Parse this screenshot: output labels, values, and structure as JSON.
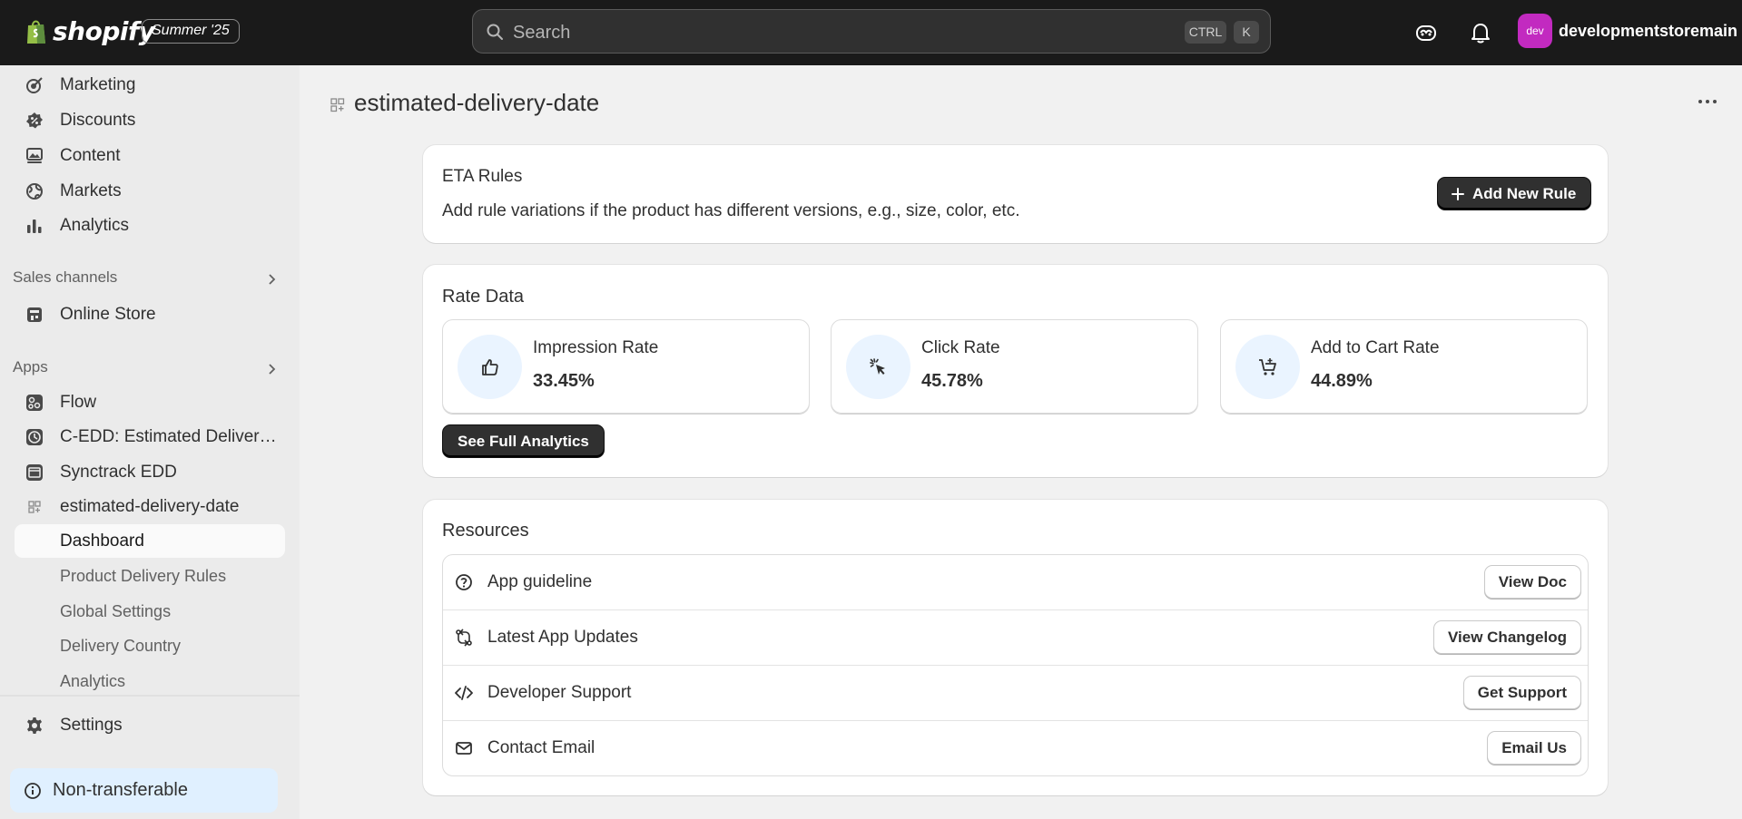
{
  "topbar": {
    "brand": "shopify",
    "edition": "Summer '25",
    "search_placeholder": "Search",
    "shortcut_ctrl": "CTRL",
    "shortcut_k": "K",
    "avatar_initials": "dev",
    "store_name": "developmentstoremain"
  },
  "sidebar": {
    "main_items": [
      {
        "label": "Marketing",
        "icon": "target-icon"
      },
      {
        "label": "Discounts",
        "icon": "discount-icon"
      },
      {
        "label": "Content",
        "icon": "content-icon"
      },
      {
        "label": "Markets",
        "icon": "globe-icon"
      },
      {
        "label": "Analytics",
        "icon": "bar-chart-icon"
      }
    ],
    "sales_channels_heading": "Sales channels",
    "sales_channels": [
      {
        "label": "Online Store",
        "icon": "store-icon"
      }
    ],
    "apps_heading": "Apps",
    "apps": [
      {
        "label": "Flow",
        "icon": "flow-icon"
      },
      {
        "label": "C-EDD: Estimated Delivery Date",
        "icon": "clock-app-icon"
      },
      {
        "label": "Synctrack EDD",
        "icon": "synctrack-app-icon"
      },
      {
        "label": "estimated-delivery-date",
        "icon": "app-grid-icon"
      }
    ],
    "app_subitems": [
      {
        "label": "Dashboard",
        "active": true
      },
      {
        "label": "Product Delivery Rules"
      },
      {
        "label": "Global Settings"
      },
      {
        "label": "Delivery Country"
      },
      {
        "label": "Analytics"
      }
    ],
    "settings_label": "Settings",
    "non_transferable_label": "Non-transferable"
  },
  "page": {
    "title": "estimated-delivery-date"
  },
  "eta_rules": {
    "title": "ETA Rules",
    "description": "Add rule variations if the product has different versions, e.g., size, color, etc.",
    "add_button": "Add New Rule"
  },
  "rate_data": {
    "title": "Rate Data",
    "stats": [
      {
        "label": "Impression Rate",
        "value": "33.45%",
        "icon": "thumbs-up-icon"
      },
      {
        "label": "Click Rate",
        "value": "45.78%",
        "icon": "cursor-click-icon"
      },
      {
        "label": "Add to Cart Rate",
        "value": "44.89%",
        "icon": "cart-add-icon"
      }
    ],
    "analytics_button": "See Full Analytics"
  },
  "resources": {
    "title": "Resources",
    "rows": [
      {
        "label": "App guideline",
        "button": "View Doc",
        "icon": "question-circle-icon"
      },
      {
        "label": "Latest App Updates",
        "button": "View Changelog",
        "icon": "changelog-icon"
      },
      {
        "label": "Developer Support",
        "button": "Get Support",
        "icon": "code-icon"
      },
      {
        "label": "Contact Email",
        "button": "Email Us",
        "icon": "email-icon"
      }
    ]
  },
  "colors": {
    "topbar_bg": "#1a1a1a",
    "sidebar_bg": "#ebebeb",
    "page_bg": "#f1f1f1",
    "primary_button": "#303030",
    "avatar_bg": "#c22ac0",
    "stat_icon_bg": "#eaf4ff",
    "badge_bg": "#e0f0ff"
  }
}
